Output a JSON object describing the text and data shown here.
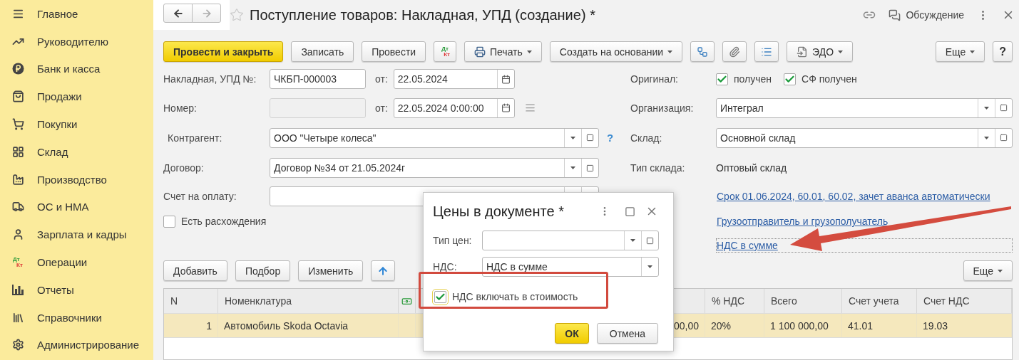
{
  "sidebar": {
    "items": [
      {
        "kind": "menu",
        "label": "Главное"
      },
      {
        "kind": "trend",
        "label": "Руководителю"
      },
      {
        "kind": "coin",
        "label": "Банк и касса"
      },
      {
        "kind": "bag",
        "label": "Продажи"
      },
      {
        "kind": "cart",
        "label": "Покупки"
      },
      {
        "kind": "grid",
        "label": "Склад"
      },
      {
        "kind": "factory",
        "label": "Производство"
      },
      {
        "kind": "truck",
        "label": "ОС и НМА"
      },
      {
        "kind": "person",
        "label": "Зарплата и кадры"
      },
      {
        "kind": "dtkt",
        "label": "Операции",
        "icon_text": [
          "Дт",
          "Кт"
        ]
      },
      {
        "kind": "chart",
        "label": "Отчеты"
      },
      {
        "kind": "books",
        "label": "Справочники"
      },
      {
        "kind": "gear",
        "label": "Администрирование"
      }
    ]
  },
  "window": {
    "title": "Поступление товаров: Накладная, УПД (создание) *",
    "discussion": "Обсуждение"
  },
  "toolbar": [
    {
      "kind": "primary",
      "label": "Провести и закрыть"
    },
    {
      "kind": "button",
      "label": "Записать"
    },
    {
      "kind": "button",
      "label": "Провести"
    },
    {
      "kind": "dtkt",
      "icon_text": [
        "Дт",
        "Кт"
      ]
    },
    {
      "kind": "print",
      "label": "Печать"
    },
    {
      "kind": "menu",
      "label": "Создать на основании"
    },
    {
      "kind": "structure"
    },
    {
      "kind": "clip"
    },
    {
      "kind": "list"
    },
    {
      "kind": "edo",
      "label": "ЭДО"
    },
    {
      "kind": "more",
      "label": "Еще"
    },
    {
      "kind": "help",
      "label": "?"
    }
  ],
  "invoice": {
    "label": "Накладная, УПД №:",
    "value": "ЧКБП-000003",
    "date_label": "от:",
    "date": "22.05.2024"
  },
  "number": {
    "label": "Номер:",
    "disabled": true,
    "date_label": "от:",
    "date": "22.05.2024  0:00:00"
  },
  "counterparty": {
    "label": "Контрагент:",
    "value": "ООО \"Четыре колеса\"",
    "help": "?"
  },
  "contract": {
    "label": "Договор:",
    "value": "Договор №34 от 21.05.2024г"
  },
  "payment_invoice": {
    "label": "Счет на оплату:"
  },
  "discrepancies": {
    "label": "Есть расхождения",
    "checked": false
  },
  "original": {
    "label": "Оригинал:",
    "checks": [
      {
        "label": "получен",
        "checked": true
      },
      {
        "label": "СФ получен",
        "checked": true
      }
    ]
  },
  "organization": {
    "label": "Организация:",
    "value": "Интеграл"
  },
  "warehouse": {
    "label": "Склад:",
    "value": "Основной склад"
  },
  "warehouse_type": {
    "label": "Тип склада:",
    "value": "Оптовый склад"
  },
  "links": [
    {
      "label": "Срок 01.06.2024, 60.01, 60.02, зачет аванса автоматически",
      "focused": false
    },
    {
      "label": "Грузоотправитель и грузополучатель",
      "focused": false
    },
    {
      "label": "НДС в сумме",
      "focused": true
    }
  ],
  "table_toolbar": {
    "buttons": [
      {
        "kind": "button",
        "label": "Добавить"
      },
      {
        "kind": "button",
        "label": "Подбор"
      },
      {
        "kind": "button",
        "label": "Изменить"
      },
      {
        "kind": "up"
      }
    ],
    "more": "Еще"
  },
  "table": {
    "columns": [
      {
        "kind": "text",
        "label": "N"
      },
      {
        "kind": "text",
        "label": "Номенклатура"
      },
      {
        "kind": "icon"
      },
      {
        "kind": "covered"
      },
      {
        "kind": "text",
        "label": "% НДС"
      },
      {
        "kind": "text",
        "label": "Всего"
      },
      {
        "kind": "text",
        "label": "Счет учета"
      },
      {
        "kind": "text",
        "label": "Счет НДС"
      }
    ],
    "rows": [
      {
        "selected": true,
        "cells": [
          "1",
          "Автомобиль Skoda Octavia",
          null,
          "00,00",
          "20%",
          "1 100 000,00",
          "41.01",
          "19.03"
        ]
      }
    ]
  },
  "dialog": {
    "title": "Цены в документе *",
    "price_type": {
      "label": "Тип цен:"
    },
    "vat": {
      "label": "НДС:",
      "value": "НДС в сумме"
    },
    "include_vat": {
      "label": "НДС включать в стоимость",
      "checked": true
    },
    "buttons": [
      {
        "kind": "primary",
        "label": "ОК"
      },
      {
        "kind": "button",
        "label": "Отмена"
      }
    ]
  },
  "annotations": {
    "highlight": true,
    "arrow": true
  }
}
